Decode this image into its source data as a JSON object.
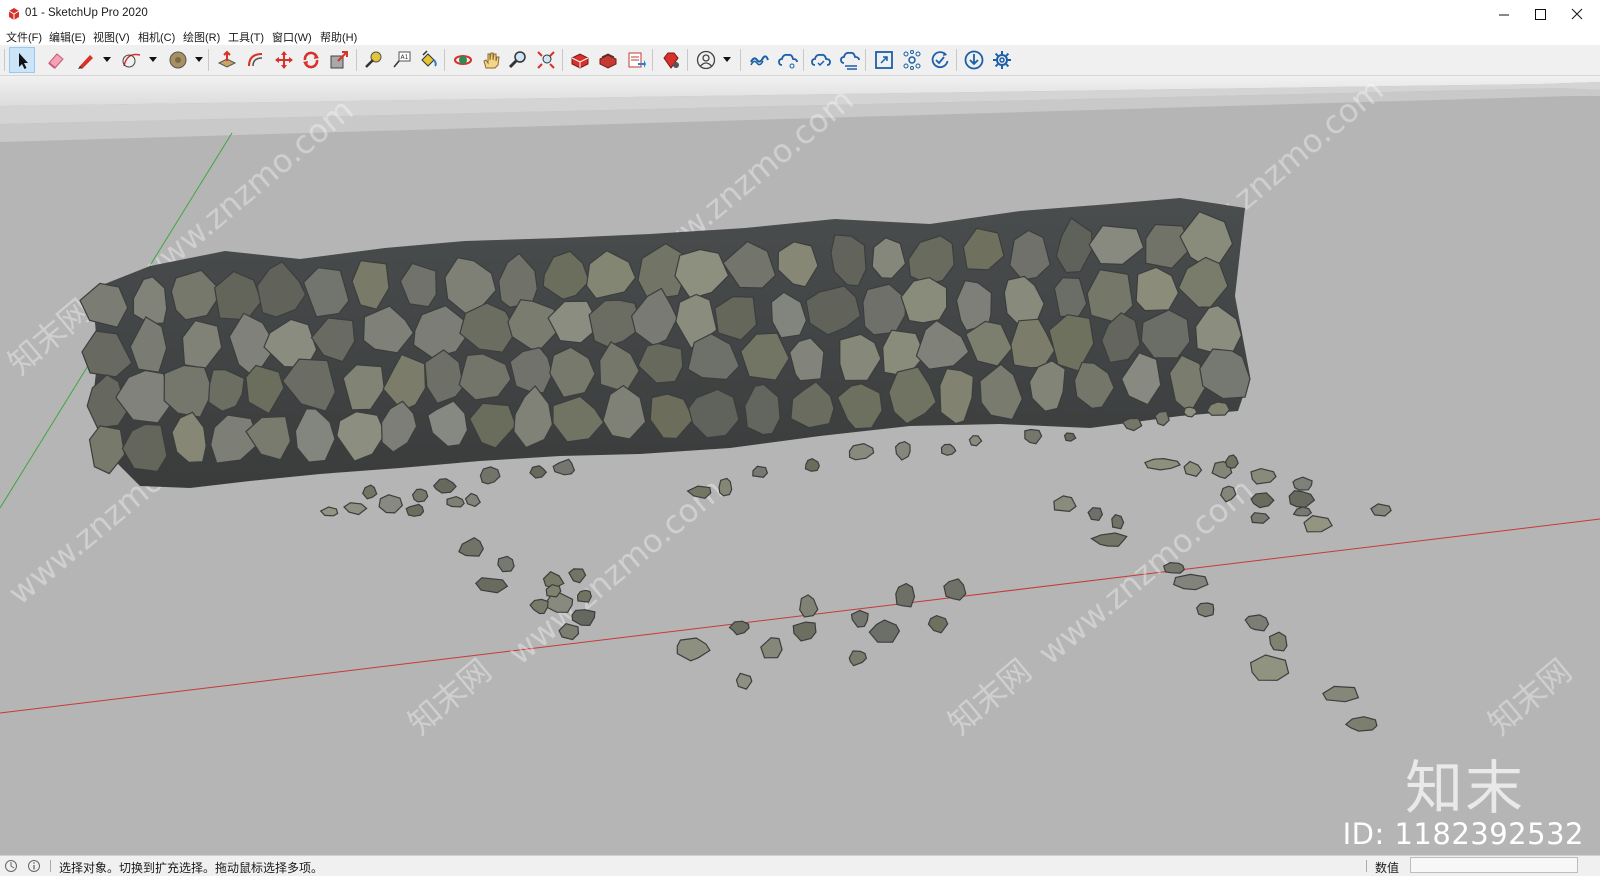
{
  "window": {
    "title": "01 - SketchUp Pro 2020",
    "controls": [
      "minimize",
      "maximize",
      "close"
    ]
  },
  "menu": {
    "items": [
      "文件(F)",
      "编辑(E)",
      "视图(V)",
      "相机(C)",
      "绘图(R)",
      "工具(T)",
      "窗口(W)",
      "帮助(H)"
    ]
  },
  "toolbar": {
    "tools": [
      {
        "name": "select-icon",
        "selected": true
      },
      {
        "name": "eraser-icon"
      },
      {
        "name": "pencil-line-icon",
        "dropdown": true
      },
      {
        "name": "arc-icon",
        "dropdown": true
      },
      {
        "name": "shape-icon",
        "dropdown": true
      },
      {
        "name": "push-pull-icon"
      },
      {
        "name": "offset-icon"
      },
      {
        "name": "move-icon"
      },
      {
        "name": "rotate-icon"
      },
      {
        "name": "scale-icon"
      },
      {
        "name": "tape-measure-icon"
      },
      {
        "name": "text-icon"
      },
      {
        "name": "paint-bucket-icon"
      },
      {
        "name": "orbit-icon"
      },
      {
        "name": "pan-icon"
      },
      {
        "name": "zoom-icon"
      },
      {
        "name": "zoom-extents-icon"
      },
      {
        "name": "3d-warehouse-icon"
      },
      {
        "name": "extension-warehouse-icon"
      },
      {
        "name": "layout-send-icon"
      },
      {
        "name": "extension-manager-icon"
      },
      {
        "name": "account-icon",
        "dropdown": true
      },
      {
        "name": "trimble-connect-icon"
      },
      {
        "name": "cloud-share-icon"
      },
      {
        "name": "cloud-sync-icon"
      },
      {
        "name": "cloud-collab-icon"
      },
      {
        "name": "frame-icon"
      },
      {
        "name": "network-icon"
      },
      {
        "name": "refresh-check-icon"
      },
      {
        "name": "download-icon"
      },
      {
        "name": "settings-gear-icon"
      }
    ]
  },
  "viewport": {
    "watermark_repeat": "www.znzmo.com",
    "watermark_cn": "知末网",
    "logo_text": "知末",
    "id_label": "ID: 1182392532",
    "colors": {
      "ground": "#b5b5b5",
      "sky": "#dadada",
      "red_axis": "#cc3333",
      "green_axis": "#33aa33",
      "stone": "#6e7070"
    }
  },
  "statusbar": {
    "message": "选择对象。切换到扩充选择。拖动鼠标选择多项。",
    "vcb_label": "数值",
    "vcb_value": ""
  }
}
